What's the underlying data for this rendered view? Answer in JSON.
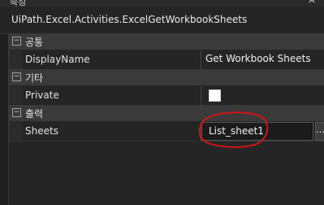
{
  "window": {
    "title": "속성",
    "close_icon": "close-icon"
  },
  "object": {
    "type_name": "UiPath.Excel.Activities.ExcelGetWorkbookSheets"
  },
  "sections": [
    {
      "label": "공통",
      "expanded": true,
      "toggle_glyph": "⊟",
      "properties": [
        {
          "name": "DisplayName",
          "value": "Get Workbook Sheets"
        }
      ]
    },
    {
      "label": "기타",
      "expanded": true,
      "toggle_glyph": "⊟",
      "properties": [
        {
          "name": "Private",
          "checked": false
        }
      ]
    },
    {
      "label": "출력",
      "expanded": true,
      "toggle_glyph": "⊟",
      "properties": [
        {
          "name": "Sheets",
          "value": "List_sheet1",
          "button_label": "..."
        }
      ]
    }
  ],
  "colors": {
    "background": "#1f1f1f",
    "section_header": "#3a3a3a",
    "annotation": "#d21414"
  }
}
